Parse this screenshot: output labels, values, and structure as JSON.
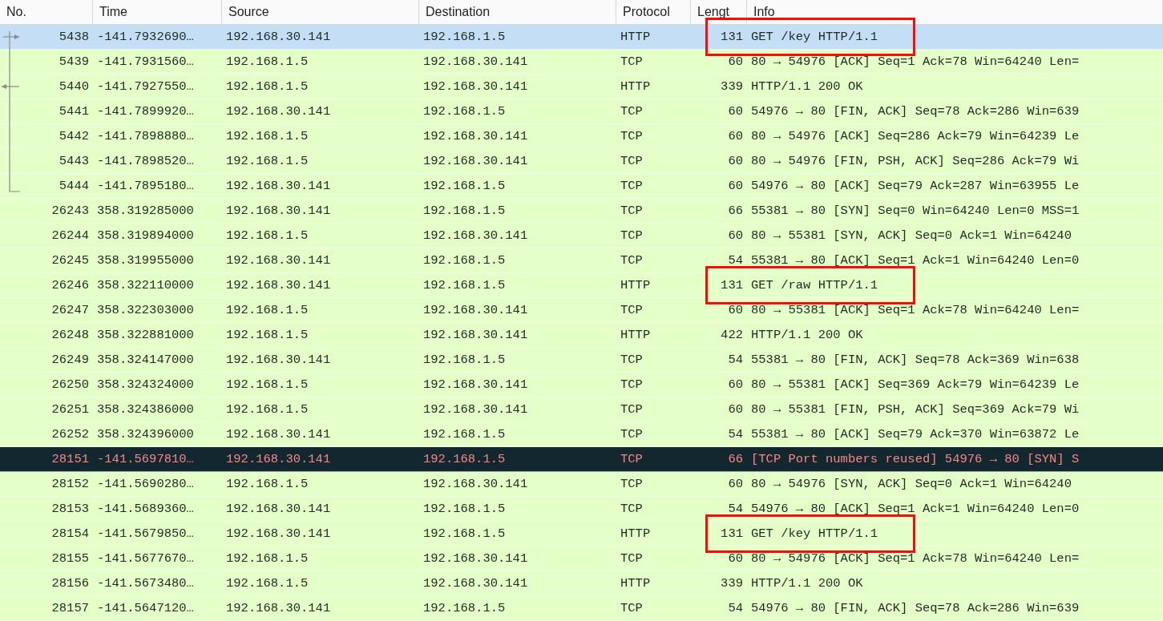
{
  "columns": [
    "No.",
    "Time",
    "Source",
    "Destination",
    "Protocol",
    "Lengt",
    "Info"
  ],
  "rows": [
    {
      "no": "5438",
      "time": "-141.7932690…",
      "source": "192.168.30.141",
      "destination": "192.168.1.5",
      "protocol": "HTTP",
      "length": "131",
      "info": "GET /key HTTP/1.1",
      "selected": true,
      "kind": "default",
      "link": {
        "kind": "request"
      },
      "highlighted": true
    },
    {
      "no": "5439",
      "time": "-141.7931560…",
      "source": "192.168.1.5",
      "destination": "192.168.30.141",
      "protocol": "TCP",
      "length": "60",
      "info": "80 → 54976 [ACK] Seq=1 Ack=78 Win=64240 Len=",
      "selected": false,
      "kind": "default",
      "link": {
        "kind": "member"
      },
      "highlighted": false
    },
    {
      "no": "5440",
      "time": "-141.7927550…",
      "source": "192.168.1.5",
      "destination": "192.168.30.141",
      "protocol": "HTTP",
      "length": "339",
      "info": "HTTP/1.1 200 OK",
      "selected": false,
      "kind": "default",
      "link": {
        "kind": "response"
      },
      "highlighted": false
    },
    {
      "no": "5441",
      "time": "-141.7899920…",
      "source": "192.168.30.141",
      "destination": "192.168.1.5",
      "protocol": "TCP",
      "length": "60",
      "info": "54976 → 80 [FIN, ACK] Seq=78 Ack=286 Win=639",
      "selected": false,
      "kind": "default",
      "link": {
        "kind": "member"
      },
      "highlighted": false
    },
    {
      "no": "5442",
      "time": "-141.7898880…",
      "source": "192.168.1.5",
      "destination": "192.168.30.141",
      "protocol": "TCP",
      "length": "60",
      "info": "80 → 54976 [ACK] Seq=286 Ack=79 Win=64239 Le",
      "selected": false,
      "kind": "default",
      "link": {
        "kind": "member"
      },
      "highlighted": false
    },
    {
      "no": "5443",
      "time": "-141.7898520…",
      "source": "192.168.1.5",
      "destination": "192.168.30.141",
      "protocol": "TCP",
      "length": "60",
      "info": "80 → 54976 [FIN, PSH, ACK] Seq=286 Ack=79 Wi",
      "selected": false,
      "kind": "default",
      "link": {
        "kind": "member"
      },
      "highlighted": false
    },
    {
      "no": "5444",
      "time": "-141.7895180…",
      "source": "192.168.30.141",
      "destination": "192.168.1.5",
      "protocol": "TCP",
      "length": "60",
      "info": "54976 → 80 [ACK] Seq=79 Ack=287 Win=63955 Le",
      "selected": false,
      "kind": "default",
      "link": {
        "kind": "last"
      },
      "highlighted": false
    },
    {
      "no": "26243",
      "time": "358.319285000",
      "source": "192.168.30.141",
      "destination": "192.168.1.5",
      "protocol": "TCP",
      "length": "66",
      "info": "55381 → 80 [SYN] Seq=0 Win=64240 Len=0 MSS=1",
      "selected": false,
      "kind": "default",
      "highlighted": false
    },
    {
      "no": "26244",
      "time": "358.319894000",
      "source": "192.168.1.5",
      "destination": "192.168.30.141",
      "protocol": "TCP",
      "length": "60",
      "info": "80 → 55381 [SYN, ACK] Seq=0 Ack=1 Win=64240",
      "selected": false,
      "kind": "default",
      "highlighted": false
    },
    {
      "no": "26245",
      "time": "358.319955000",
      "source": "192.168.30.141",
      "destination": "192.168.1.5",
      "protocol": "TCP",
      "length": "54",
      "info": "55381 → 80 [ACK] Seq=1 Ack=1 Win=64240 Len=0",
      "selected": false,
      "kind": "default",
      "highlighted": false
    },
    {
      "no": "26246",
      "time": "358.322110000",
      "source": "192.168.30.141",
      "destination": "192.168.1.5",
      "protocol": "HTTP",
      "length": "131",
      "info": "GET /raw HTTP/1.1",
      "selected": false,
      "kind": "default",
      "highlighted": true
    },
    {
      "no": "26247",
      "time": "358.322303000",
      "source": "192.168.1.5",
      "destination": "192.168.30.141",
      "protocol": "TCP",
      "length": "60",
      "info": "80 → 55381 [ACK] Seq=1 Ack=78 Win=64240 Len=",
      "selected": false,
      "kind": "default",
      "highlighted": false
    },
    {
      "no": "26248",
      "time": "358.322881000",
      "source": "192.168.1.5",
      "destination": "192.168.30.141",
      "protocol": "HTTP",
      "length": "422",
      "info": "HTTP/1.1 200 OK",
      "selected": false,
      "kind": "default",
      "highlighted": false
    },
    {
      "no": "26249",
      "time": "358.324147000",
      "source": "192.168.30.141",
      "destination": "192.168.1.5",
      "protocol": "TCP",
      "length": "54",
      "info": "55381 → 80 [FIN, ACK] Seq=78 Ack=369 Win=638",
      "selected": false,
      "kind": "default",
      "highlighted": false
    },
    {
      "no": "26250",
      "time": "358.324324000",
      "source": "192.168.1.5",
      "destination": "192.168.30.141",
      "protocol": "TCP",
      "length": "60",
      "info": "80 → 55381 [ACK] Seq=369 Ack=79 Win=64239 Le",
      "selected": false,
      "kind": "default",
      "highlighted": false
    },
    {
      "no": "26251",
      "time": "358.324386000",
      "source": "192.168.1.5",
      "destination": "192.168.30.141",
      "protocol": "TCP",
      "length": "60",
      "info": "80 → 55381 [FIN, PSH, ACK] Seq=369 Ack=79 Wi",
      "selected": false,
      "kind": "default",
      "highlighted": false
    },
    {
      "no": "26252",
      "time": "358.324396000",
      "source": "192.168.30.141",
      "destination": "192.168.1.5",
      "protocol": "TCP",
      "length": "54",
      "info": "55381 → 80 [ACK] Seq=79 Ack=370 Win=63872 Le",
      "selected": false,
      "kind": "default",
      "highlighted": false
    },
    {
      "no": "28151",
      "time": "-141.5697810…",
      "source": "192.168.30.141",
      "destination": "192.168.1.5",
      "protocol": "TCP",
      "length": "66",
      "info": "[TCP Port numbers reused] 54976 → 80 [SYN] S",
      "selected": false,
      "kind": "bad-tcp",
      "highlighted": false
    },
    {
      "no": "28152",
      "time": "-141.5690280…",
      "source": "192.168.1.5",
      "destination": "192.168.30.141",
      "protocol": "TCP",
      "length": "60",
      "info": "80 → 54976 [SYN, ACK] Seq=0 Ack=1 Win=64240",
      "selected": false,
      "kind": "default",
      "highlighted": false
    },
    {
      "no": "28153",
      "time": "-141.5689360…",
      "source": "192.168.30.141",
      "destination": "192.168.1.5",
      "protocol": "TCP",
      "length": "54",
      "info": "54976 → 80 [ACK] Seq=1 Ack=1 Win=64240 Len=0",
      "selected": false,
      "kind": "default",
      "highlighted": false
    },
    {
      "no": "28154",
      "time": "-141.5679850…",
      "source": "192.168.30.141",
      "destination": "192.168.1.5",
      "protocol": "HTTP",
      "length": "131",
      "info": "GET /key HTTP/1.1",
      "selected": false,
      "kind": "default",
      "highlighted": true
    },
    {
      "no": "28155",
      "time": "-141.5677670…",
      "source": "192.168.1.5",
      "destination": "192.168.30.141",
      "protocol": "TCP",
      "length": "60",
      "info": "80 → 54976 [ACK] Seq=1 Ack=78 Win=64240 Len=",
      "selected": false,
      "kind": "default",
      "highlighted": false
    },
    {
      "no": "28156",
      "time": "-141.5673480…",
      "source": "192.168.1.5",
      "destination": "192.168.30.141",
      "protocol": "HTTP",
      "length": "339",
      "info": "HTTP/1.1 200 OK",
      "selected": false,
      "kind": "default",
      "highlighted": false
    },
    {
      "no": "28157",
      "time": "-141.5647120…",
      "source": "192.168.30.141",
      "destination": "192.168.1.5",
      "protocol": "TCP",
      "length": "54",
      "info": "54976 → 80 [FIN, ACK] Seq=78 Ack=286 Win=639",
      "selected": false,
      "kind": "default",
      "highlighted": false
    }
  ]
}
